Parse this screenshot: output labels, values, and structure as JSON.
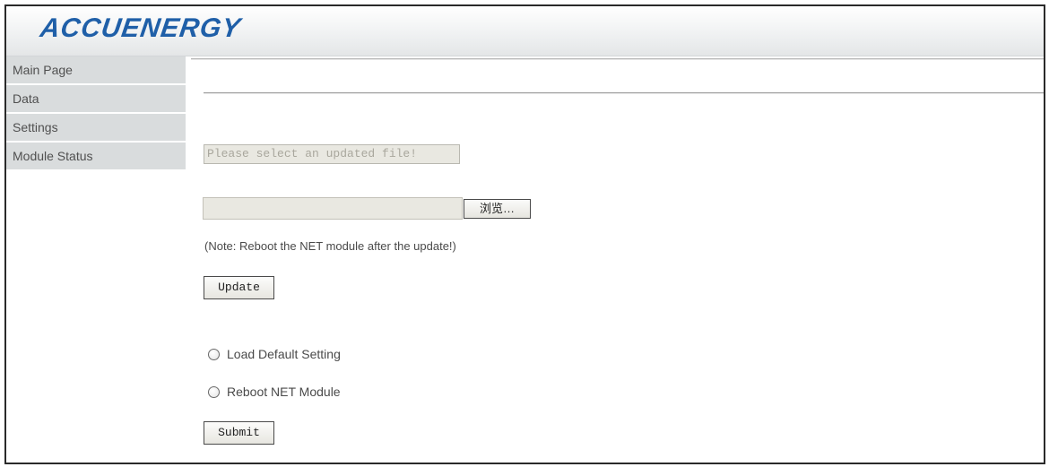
{
  "header": {
    "logo_text": "ACCUENERGY"
  },
  "sidebar": {
    "items": [
      {
        "label": "Main Page"
      },
      {
        "label": "Data"
      },
      {
        "label": "Settings"
      },
      {
        "label": "Module Status"
      }
    ]
  },
  "update_section": {
    "file_status": "Please select an updated file!",
    "file_path_value": "",
    "browse_label": "浏览…",
    "note": "(Note: Reboot the NET module after the update!)",
    "update_label": "Update"
  },
  "options": {
    "radios": [
      {
        "label": "Load Default Setting",
        "checked": false
      },
      {
        "label": "Reboot NET Module",
        "checked": false
      }
    ],
    "submit_label": "Submit"
  },
  "colors": {
    "logo": "#1f5fa8",
    "sidebar_bg": "#d9dcdd"
  }
}
